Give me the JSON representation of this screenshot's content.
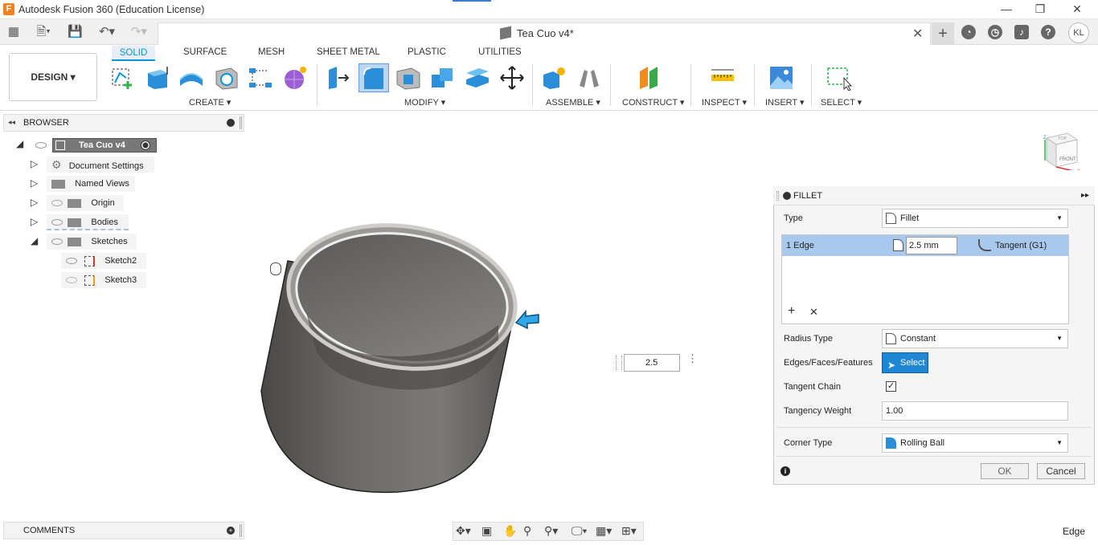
{
  "window": {
    "title": "Autodesk Fusion 360 (Education License)",
    "app_icon_letter": "F",
    "minimize": "—",
    "restore": "❐",
    "close": "✕"
  },
  "document": {
    "title": "Tea Cuo v4*",
    "close": "✕",
    "new_tab": "+"
  },
  "user": {
    "initials": "KL"
  },
  "workspace": {
    "label": "DESIGN ▾"
  },
  "ribbon": {
    "tabs": [
      "SOLID",
      "SURFACE",
      "MESH",
      "SHEET METAL",
      "PLASTIC",
      "UTILITIES"
    ],
    "groups": [
      "CREATE ▾",
      "MODIFY ▾",
      "ASSEMBLE ▾",
      "CONSTRUCT ▾",
      "INSPECT ▾",
      "INSERT ▾",
      "SELECT ▾"
    ]
  },
  "browser": {
    "title": "BROWSER",
    "root": "Tea Cuo v4",
    "items": [
      "Document Settings",
      "Named Views",
      "Origin",
      "Bodies",
      "Sketches"
    ],
    "sketches": [
      "Sketch2",
      "Sketch3"
    ]
  },
  "comments": {
    "title": "COMMENTS"
  },
  "viewport": {
    "dimension_value": "2.5"
  },
  "viewcube": {
    "top": "TOP",
    "front": "FRONT",
    "z": "Z",
    "x": "X"
  },
  "fillet": {
    "title": "FILLET",
    "type_label": "Type",
    "type_value": "Fillet",
    "edge_label": "1 Edge",
    "edge_radius": "2.5 mm",
    "edge_continuity": "Tangent (G1)",
    "radius_type_label": "Radius Type",
    "radius_type_value": "Constant",
    "selection_label": "Edges/Faces/Features",
    "select_button": "Select",
    "tangent_chain_label": "Tangent Chain",
    "tangent_chain_checked": true,
    "tangency_weight_label": "Tangency Weight",
    "tangency_weight_value": "1.00",
    "corner_type_label": "Corner Type",
    "corner_type_value": "Rolling Ball",
    "ok": "OK",
    "cancel": "Cancel"
  },
  "status": {
    "selection": "Edge"
  },
  "colors": {
    "accent": "#0696d7",
    "select_blue": "#1e88d6",
    "row_highlight": "#a8c8ee",
    "body": "#6f6d6a"
  }
}
